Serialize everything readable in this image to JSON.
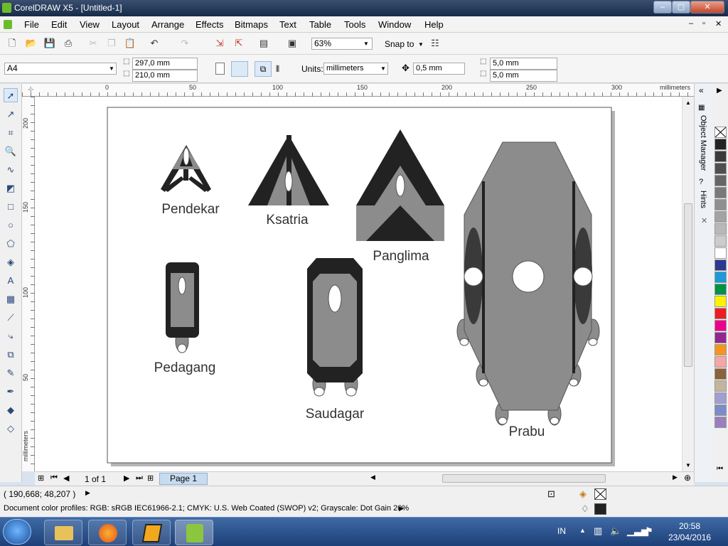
{
  "window": {
    "title": "CorelDRAW X5 - [Untitled-1]",
    "min": "–",
    "max": "▢",
    "close": "✕"
  },
  "menu": [
    "File",
    "Edit",
    "View",
    "Layout",
    "Arrange",
    "Effects",
    "Bitmaps",
    "Text",
    "Table",
    "Tools",
    "Window",
    "Help"
  ],
  "toolbar": {
    "zoom": "63%",
    "snap": "Snap to"
  },
  "property_bar": {
    "paper": "A4",
    "width": "297,0 mm",
    "height": "210,0 mm",
    "units_label": "Units:",
    "units": "millimeters",
    "nudge": "0,5 mm",
    "dup_x": "5,0 mm",
    "dup_y": "5,0 mm"
  },
  "rulers": {
    "top_ticks": [
      "0",
      "50",
      "100",
      "150",
      "200",
      "250",
      "300"
    ],
    "top_unit": "millimeters",
    "left_ticks": [
      "200",
      "150",
      "100",
      "50"
    ],
    "left_unit": "millimeters"
  },
  "drawing": {
    "labels": {
      "pendekar": "Pendekar",
      "ksatria": "Ksatria",
      "panglima": "Panglima",
      "pedagang": "Pedagang",
      "saudagar": "Saudagar",
      "prabu": "Prabu"
    },
    "colors": {
      "dark": "#222222",
      "gray": "#8c8c8c",
      "stroke": "#555555"
    }
  },
  "dockers": {
    "object_manager": "Object Manager",
    "hints": "Hints"
  },
  "palette": [
    "#222222",
    "#3a3a3a",
    "#4f4f4f",
    "#666666",
    "#7a7a7a",
    "#8f8f8f",
    "#a3a3a3",
    "#b8b8b8",
    "#cccccc",
    "#ffffff",
    "#2b3990",
    "#1d9ad6",
    "#009245",
    "#fff200",
    "#ed1c24",
    "#ec008c",
    "#92278f",
    "#f7941d",
    "#f6a6a6",
    "#8c6239",
    "#c2b59b",
    "#a39ed2",
    "#7b8cc8",
    "#9a7fbf"
  ],
  "pages": {
    "counter": "1 of 1",
    "tab": "Page 1"
  },
  "status": {
    "coords": "( 190,668; 48,207 )",
    "profiles": "Document color profiles: RGB: sRGB IEC61966-2.1; CMYK: U.S. Web Coated (SWOP) v2; Grayscale: Dot Gain 20%"
  },
  "taskbar": {
    "lang": "IN",
    "time": "20:58",
    "date": "23/04/2016"
  }
}
